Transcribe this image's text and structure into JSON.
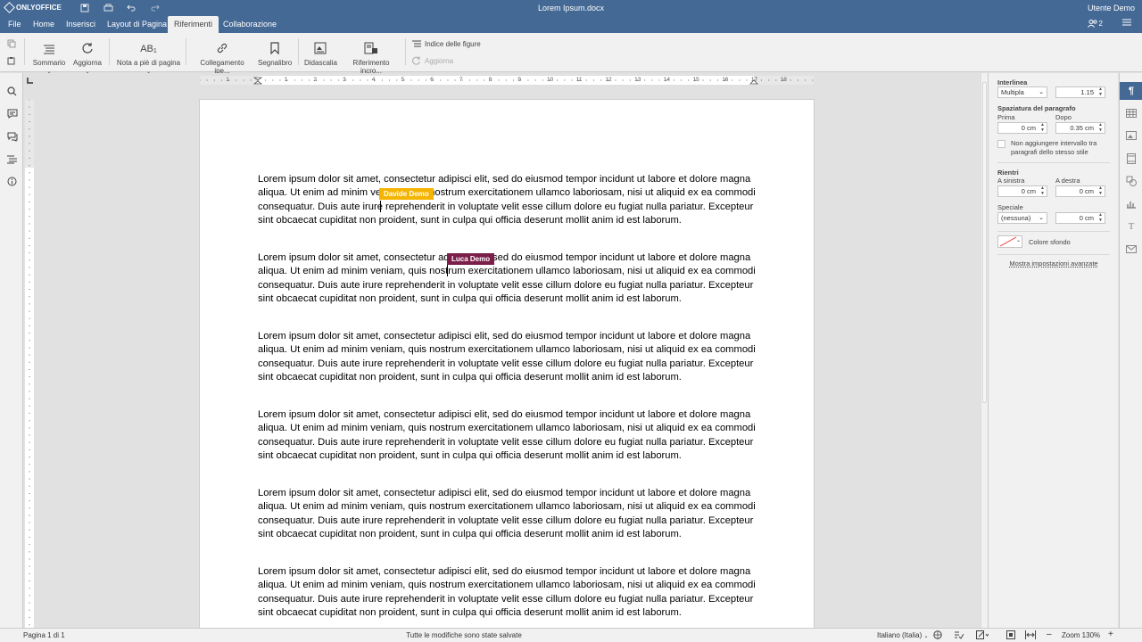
{
  "app": {
    "name": "ONLYOFFICE",
    "doc_title": "Lorem Ipsum.docx",
    "user": "Utente Demo"
  },
  "menu": {
    "tabs": [
      "File",
      "Home",
      "Inserisci",
      "Layout di Pagina",
      "Riferimenti",
      "Collaborazione"
    ],
    "active": "Riferimenti",
    "users_count": "2"
  },
  "toolbar": {
    "sommario": "Sommario",
    "aggiorna": "Aggiorna",
    "footnote": "Nota a piè di pagina",
    "footnote_icon_text": "AB",
    "hyperlink": "Collegamento ipe...",
    "bookmark": "Segnalibro",
    "caption": "Didascalia",
    "crossref": "Riferimento incro...",
    "figures_index": "Indice delle figure",
    "refresh": "Aggiorna"
  },
  "document": {
    "paragraphs": [
      "Lorem ipsum dolor sit amet, consectetur adipisci elit, sed do eiusmod tempor incidunt ut labore et dolore magna aliqua. Ut enim ad minim veniam, quis nostrum exercitationem ullamco laboriosam, nisi ut aliquid ex ea commodi consequatur. Duis aute irure reprehenderit in voluptate velit esse cillum dolore eu fugiat nulla pariatur. Excepteur sint obcaecat cupiditat non proident, sunt in culpa qui officia deserunt mollit anim id est laborum.",
      "Lorem ipsum dolor sit amet, consectetur adipisci elit, sed do eiusmod tempor incidunt ut labore et dolore magna aliqua. Ut enim ad minim veniam, quis nostrum exercitationem ullamco laboriosam, nisi ut aliquid ex ea commodi consequatur. Duis aute irure reprehenderit in voluptate velit esse cillum dolore eu fugiat nulla pariatur. Excepteur sint obcaecat cupiditat non proident, sunt in culpa qui officia deserunt mollit anim id est laborum.",
      "Lorem ipsum dolor sit amet, consectetur adipisci elit, sed do eiusmod tempor incidunt ut labore et dolore magna aliqua. Ut enim ad minim veniam, quis nostrum exercitationem ullamco laboriosam, nisi ut aliquid ex ea commodi consequatur. Duis aute irure reprehenderit in voluptate velit esse cillum dolore eu fugiat nulla pariatur. Excepteur sint obcaecat cupiditat non proident, sunt in culpa qui officia deserunt mollit anim id est laborum.",
      "Lorem ipsum dolor sit amet, consectetur adipisci elit, sed do eiusmod tempor incidunt ut labore et dolore magna aliqua. Ut enim ad minim veniam, quis nostrum exercitationem ullamco laboriosam, nisi ut aliquid ex ea commodi consequatur. Duis aute irure reprehenderit in voluptate velit esse cillum dolore eu fugiat nulla pariatur. Excepteur sint obcaecat cupiditat non proident, sunt in culpa qui officia deserunt mollit anim id est laborum.",
      "Lorem ipsum dolor sit amet, consectetur adipisci elit, sed do eiusmod tempor incidunt ut labore et dolore magna aliqua. Ut enim ad minim veniam, quis nostrum exercitationem ullamco laboriosam, nisi ut aliquid ex ea commodi consequatur. Duis aute irure reprehenderit in voluptate velit esse cillum dolore eu fugiat nulla pariatur. Excepteur sint obcaecat cupiditat non proident, sunt in culpa qui officia deserunt mollit anim id est laborum.",
      "Lorem ipsum dolor sit amet, consectetur adipisci elit, sed do eiusmod tempor incidunt ut labore et dolore magna aliqua. Ut enim ad minim veniam, quis nostrum exercitationem ullamco laboriosam, nisi ut aliquid ex ea commodi consequatur. Duis aute irure reprehenderit in voluptate velit esse cillum dolore eu fugiat nulla pariatur. Excepteur sint obcaecat cupiditat non proident, sunt in culpa qui officia deserunt mollit anim id est laborum."
    ],
    "collaborators": [
      {
        "name": "Davide Demo",
        "color": "#f4b400"
      },
      {
        "name": "Luca Demo",
        "color": "#7a1f4a"
      }
    ]
  },
  "ruler": {
    "h_numbers": [
      "1",
      "1",
      "2",
      "3",
      "4",
      "5",
      "6",
      "7",
      "8",
      "9",
      "10",
      "11",
      "12",
      "13",
      "14",
      "15",
      "16",
      "17",
      "18"
    ]
  },
  "paragraph_settings": {
    "interlinea_title": "Interlinea",
    "interlinea_type": "Multipla",
    "interlinea_value": "1.15",
    "spacing_title": "Spaziatura del paragrafo",
    "before_label": "Prima",
    "after_label": "Dopo",
    "before_value": "0 cm",
    "after_value": "0.35 cm",
    "no_space_label": "Non aggiungere intervallo tra paragrafi dello stesso stile",
    "rientri_title": "Rientri",
    "left_label": "A sinistra",
    "right_label": "A destra",
    "left_value": "0 cm",
    "right_value": "0 cm",
    "special_label": "Speciale",
    "special_value": "(nessuna)",
    "special_amount": "0 cm",
    "bg_color_label": "Colore sfondo",
    "advanced_link": "Mostra impostazioni avanzate"
  },
  "status": {
    "page": "Pagina 1 di 1",
    "save_state": "Tutte le modifiche sono state salvate",
    "language": "Italiano (Italia)",
    "zoom": "Zoom 130%",
    "zoom_minus": "–",
    "zoom_plus": "+"
  },
  "colors": {
    "brand": "#446995",
    "toolbar_bg": "#f1f1f1",
    "workspace": "#e1e1e1"
  }
}
